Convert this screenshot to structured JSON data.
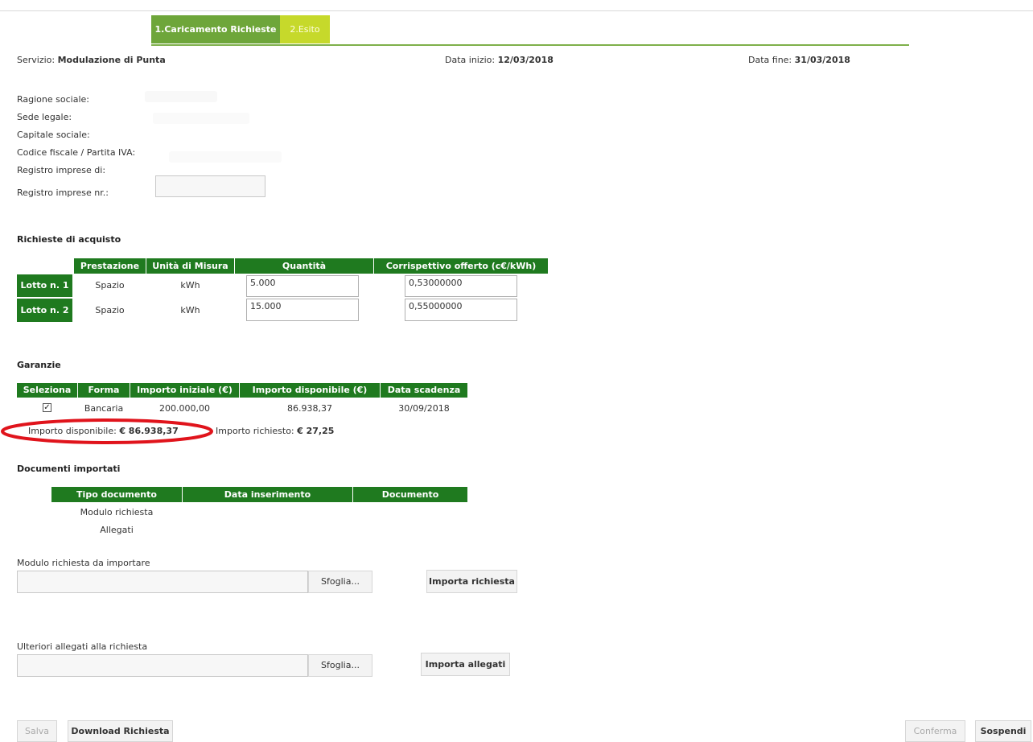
{
  "tabs": [
    {
      "label": "1.Caricamento Richieste"
    },
    {
      "label": "2.Esito"
    }
  ],
  "service": {
    "servizio_label": "Servizio: ",
    "servizio_value": "Modulazione di Punta",
    "data_inizio_label": "Data inizio: ",
    "data_inizio_value": "12/03/2018",
    "data_fine_label": "Data fine: ",
    "data_fine_value": "31/03/2018"
  },
  "company": {
    "ragione_sociale": "Ragione sociale:",
    "sede_legale": "Sede legale:",
    "capitale_sociale": "Capitale sociale:",
    "codice_fiscale": "Codice fiscale / Partita IVA:",
    "registro_di": "Registro imprese di:",
    "registro_nr": "Registro imprese nr.:",
    "registro_nr_value": ""
  },
  "richieste": {
    "title": "Richieste di acquisto",
    "headers": [
      "Prestazione",
      "Unità di Misura",
      "Quantità",
      "Corrispettivo offerto (c€/kWh)"
    ],
    "rows": [
      {
        "lotto": "Lotto n. 1",
        "prestazione": "Spazio",
        "unita": "kWh",
        "quantita": "5.000",
        "corrispettivo": "0,53000000"
      },
      {
        "lotto": "Lotto n. 2",
        "prestazione": "Spazio",
        "unita": "kWh",
        "quantita": "15.000",
        "corrispettivo": "0,55000000"
      }
    ]
  },
  "garanzie": {
    "title": "Garanzie",
    "headers": [
      "Seleziona",
      "Forma",
      "Importo iniziale (€)",
      "Importo disponibile (€)",
      "Data scadenza"
    ],
    "row": {
      "checked": "✓",
      "forma": "Bancaria",
      "iniziale": "200.000,00",
      "disponibile": "86.938,37",
      "scadenza": "30/09/2018"
    },
    "disp_label": "Importo disponibile: ",
    "disp_value": "€ 86.938,37",
    "rich_label": "Importo richiesto: ",
    "rich_value": "€ 27,25",
    "highlight_color": "#e0141c"
  },
  "documenti": {
    "title": "Documenti importati",
    "headers": [
      "Tipo documento",
      "Data inserimento",
      "Documento"
    ],
    "rows": [
      "Modulo richiesta",
      "Allegati"
    ]
  },
  "modulo": {
    "label": "Modulo richiesta da importare",
    "browse": "Sfoglia...",
    "import": "Importa richiesta"
  },
  "allegati": {
    "label": "Ulteriori allegati alla richiesta",
    "browse": "Sfoglia...",
    "import": "Importa allegati"
  },
  "footer": {
    "salva": "Salva",
    "download": "Download Richiesta",
    "conferma": "Conferma",
    "sospendi": "Sospendi"
  },
  "colors": {
    "header_green": "#1f7a1f",
    "tab_active": "#6ea63a",
    "tab_next": "#c6d92b"
  }
}
